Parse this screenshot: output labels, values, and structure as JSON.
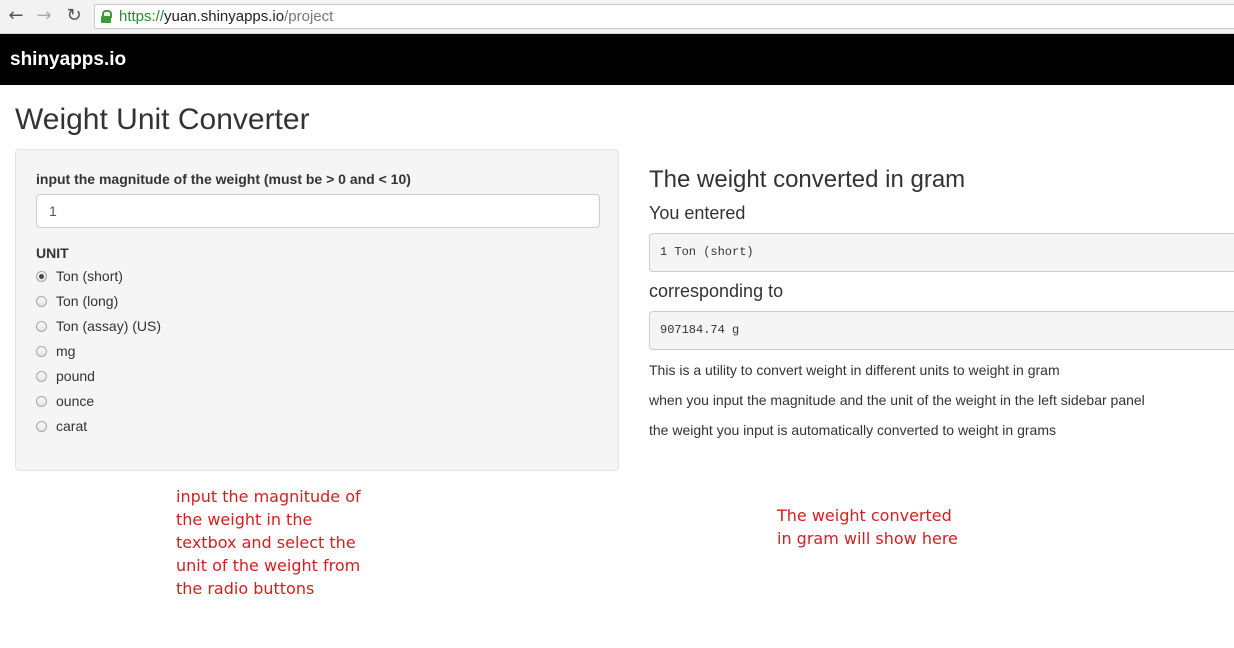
{
  "browser": {
    "back_icon": "arrow-left",
    "forward_icon": "arrow-right",
    "reload_icon": "reload",
    "url_scheme": "https://",
    "url_host": "yuan.shinyapps.io",
    "url_path": "/project"
  },
  "navbar": {
    "brand": "shinyapps.io"
  },
  "page": {
    "title": "Weight Unit Converter"
  },
  "sidebar": {
    "magnitude_label": "input the magnitude of the weight (must be > 0 and < 10)",
    "magnitude_value": "1",
    "unit_label": "UNIT",
    "unit_options": [
      {
        "label": "Ton (short)",
        "selected": true
      },
      {
        "label": "Ton (long)",
        "selected": false
      },
      {
        "label": "Ton (assay) (US)",
        "selected": false
      },
      {
        "label": "mg",
        "selected": false
      },
      {
        "label": "pound",
        "selected": false
      },
      {
        "label": "ounce",
        "selected": false
      },
      {
        "label": "carat",
        "selected": false
      }
    ]
  },
  "main": {
    "heading": "The weight converted in gram",
    "entered_label": "You entered",
    "entered_value": "1 Ton (short)",
    "corresponding_label": "corresponding to",
    "converted_value": "907184.74 g",
    "description": [
      "This is a utility to convert weight in different units to weight in gram",
      "when you input the magnitude and the unit of the weight in the left sidebar panel",
      "the weight you input is automatically converted to weight in grams"
    ]
  },
  "annotations": {
    "left_lines": [
      "input the magnitude of",
      "the weight in the",
      "textbox and select the",
      "unit of the weight from",
      "the radio buttons"
    ],
    "right_lines": [
      "The weight converted",
      "in gram will show here"
    ],
    "color": "#d21f1f"
  }
}
